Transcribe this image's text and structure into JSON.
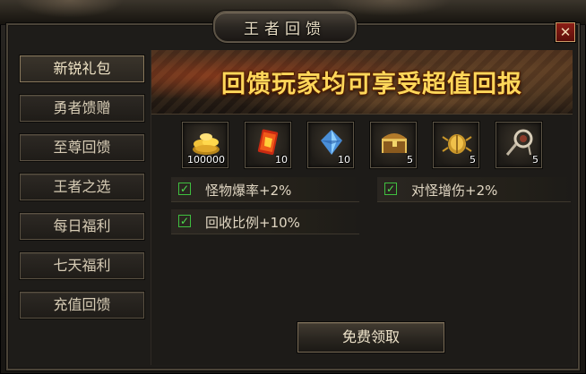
{
  "window": {
    "title": "王者回馈",
    "close_label": "✕"
  },
  "sidebar": {
    "items": [
      {
        "label": "新锐礼包",
        "active": true
      },
      {
        "label": "勇者馈赠"
      },
      {
        "label": "至尊回馈"
      },
      {
        "label": "王者之选"
      },
      {
        "label": "每日福利"
      },
      {
        "label": "七天福利"
      },
      {
        "label": "充值回馈"
      }
    ]
  },
  "banner": {
    "text": "回馈玩家均可享受超值回报"
  },
  "rewards": [
    {
      "icon": "gold-coins-icon",
      "qty": "100000"
    },
    {
      "icon": "red-scroll-icon",
      "qty": "10"
    },
    {
      "icon": "blue-crystal-icon",
      "qty": "10"
    },
    {
      "icon": "treasure-chest-icon",
      "qty": "5"
    },
    {
      "icon": "golden-beetle-icon",
      "qty": "5"
    },
    {
      "icon": "rope-tool-icon",
      "qty": "5"
    }
  ],
  "bonuses": [
    {
      "label": "怪物爆率+2%",
      "checked": true
    },
    {
      "label": "对怪增伤+2%",
      "checked": true
    },
    {
      "label": "回收比例+10%",
      "checked": true
    }
  ],
  "claim_button": {
    "label": "免费领取"
  },
  "colors": {
    "banner_text": "#ffd75a",
    "checkbox": "#4ee04e",
    "close_red": "#8c1e16"
  }
}
